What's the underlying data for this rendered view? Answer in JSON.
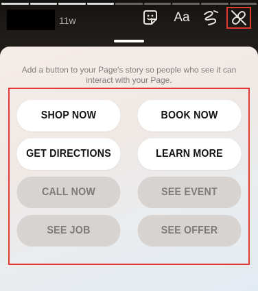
{
  "story": {
    "timestamp": "11w",
    "progress_segments": 9,
    "progress_done": 4
  },
  "toolbar": {
    "text_tool_label": "Aa",
    "icons": [
      "sticker-icon",
      "text-icon",
      "draw-icon",
      "link-icon"
    ]
  },
  "sheet": {
    "instructions": "Add a button to your Page's story so people who see it can interact with your Page.",
    "options": [
      {
        "label": "SHOP NOW",
        "enabled": true
      },
      {
        "label": "BOOK NOW",
        "enabled": true
      },
      {
        "label": "GET DIRECTIONS",
        "enabled": true
      },
      {
        "label": "LEARN MORE",
        "enabled": true
      },
      {
        "label": "CALL NOW",
        "enabled": false
      },
      {
        "label": "SEE EVENT",
        "enabled": false
      },
      {
        "label": "SEE JOB",
        "enabled": false
      },
      {
        "label": "SEE OFFER",
        "enabled": false
      }
    ]
  },
  "colors": {
    "highlight": "#e23a33",
    "button_active_bg": "#ffffff",
    "button_inactive_bg": "#d6d3d1"
  }
}
